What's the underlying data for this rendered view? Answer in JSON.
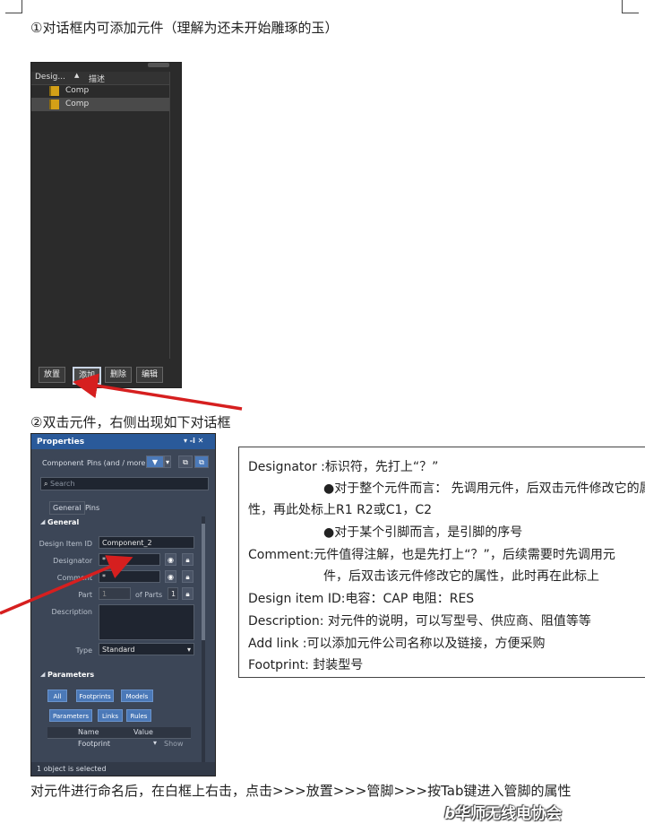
{
  "section1": {
    "heading": "①对话框内可添加元件（理解为还未开始雕琢的玉）",
    "columns": [
      "Desig...",
      "描述"
    ],
    "rows": [
      "Comp",
      "Comp"
    ],
    "buttons": [
      "放置",
      "添加",
      "删除",
      "编辑"
    ]
  },
  "section2": {
    "heading": "②双击元件，右侧出现如下对话框"
  },
  "properties": {
    "title": "Properties",
    "window_controls": "▾ ‑ⅰ ✕",
    "filter_label": "Component",
    "filter_value": "Pins (and / more)",
    "search_placeholder": "Search",
    "tabs": [
      "General",
      "Pins"
    ],
    "general_header": "General",
    "fields": [
      {
        "label": "Design Item ID",
        "value": "Component_2"
      },
      {
        "label": "Designator",
        "value": "*"
      },
      {
        "label": "Comment",
        "value": "*"
      }
    ],
    "part_label": "Part",
    "part_value": "1",
    "of_parts_label": "of Parts",
    "of_parts_value": "1",
    "description_label": "Description",
    "type_label": "Type",
    "type_value": "Standard",
    "parameters_header": "Parameters",
    "param_buttons_row1": [
      "All",
      "Footprints",
      "Models"
    ],
    "param_buttons_row2": [
      "Parameters",
      "Links",
      "Rules"
    ],
    "table_headers": [
      "Name",
      "Value"
    ],
    "table_row": {
      "name": "Footprint",
      "action": "Show"
    },
    "status": "1 object is selected"
  },
  "explanation": {
    "lines": [
      "Designator :标识符，先打上“？”",
      "●对于整个元件而言：  先调用元件，后双击元件修改它的属",
      "性，再此处标上R1    R2或C1，C2",
      "●对于某个引脚而言，是引脚的序号",
      "Comment:元件值得注解，也是先打上“？”，后续需要时先调用元",
      "件，后双击该元件修改它的属性，此时再在此标上",
      "Design item ID:电容：CAP        电阻：RES",
      "Description: 对元件的说明，可以写型号、供应商、阻值等等",
      "Add link :可以添加元件公司名称以及链接，方便采购",
      "Footprint:  封装型号"
    ]
  },
  "footer_text": "对元件进行命名后，在白框上右击，点击>>>放置>>>管脚>>>按Tab键进入管脚的属性",
  "watermark": "华师无线电协会",
  "colors": {
    "arrow": "#d61f1f",
    "panel_bg": "#2b2b2b",
    "props_bg": "#3c4657",
    "props_accent": "#2a5a9a",
    "button_blue": "#4b79b8"
  }
}
